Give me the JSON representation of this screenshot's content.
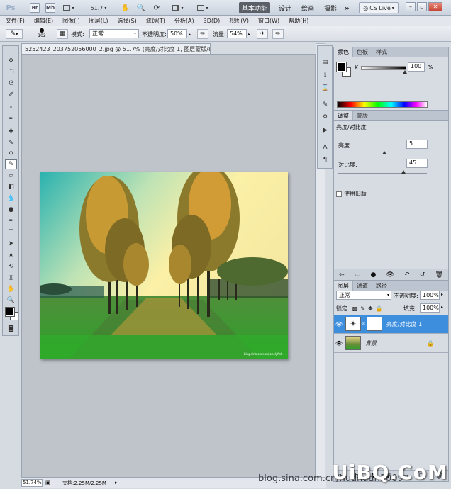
{
  "titlebar": {
    "app_logo": "Ps",
    "zoom": "51.7",
    "workspaces": [
      "基本功能",
      "设计",
      "绘画",
      "摄影"
    ],
    "more": "»",
    "cslive": "CS Live"
  },
  "menu": [
    "文件(F)",
    "编辑(E)",
    "图像(I)",
    "图层(L)",
    "选择(S)",
    "滤镜(T)",
    "分析(A)",
    "3D(D)",
    "视图(V)",
    "窗口(W)",
    "帮助(H)"
  ],
  "options": {
    "brush_size": "102",
    "mode_label": "模式:",
    "mode_value": "正常",
    "opacity_label": "不透明度:",
    "opacity_value": "50%",
    "flow_label": "流量:",
    "flow_value": "54%"
  },
  "document": {
    "tab_title": "5252423_203752056000_2.jpg @ 51.7% (亮度/对比度 1, 图层蒙版/8) *",
    "tab_close": "×",
    "zoom_status": "51.74%",
    "doc_info": "文档:2.25M/2.25M",
    "photo_watermark": "blog.sina.com.cn/lonelyfish"
  },
  "color_panel": {
    "tabs": [
      "颜色",
      "色板",
      "样式"
    ],
    "channel": "K",
    "value": "100",
    "unit": "%"
  },
  "adjust_panel": {
    "tabs": [
      "调整",
      "蒙版"
    ],
    "title": "亮度/对比度",
    "brightness_label": "亮度:",
    "brightness_value": "5",
    "contrast_label": "对比度:",
    "contrast_value": "45",
    "legacy_label": "使用旧版"
  },
  "layers_panel": {
    "tabs": [
      "图层",
      "通道",
      "路径"
    ],
    "blend_mode": "正常",
    "opacity_label": "不透明度:",
    "opacity_value": "100%",
    "lock_label": "锁定:",
    "fill_label": "填充:",
    "fill_value": "100%",
    "layers": [
      {
        "name": "亮度/对比度 1",
        "selected": true
      },
      {
        "name": "背景",
        "selected": false
      }
    ]
  },
  "watermark": {
    "blog": "blog.sina.com.cn/huahuan1009",
    "site": "UiBQ.CoM"
  }
}
